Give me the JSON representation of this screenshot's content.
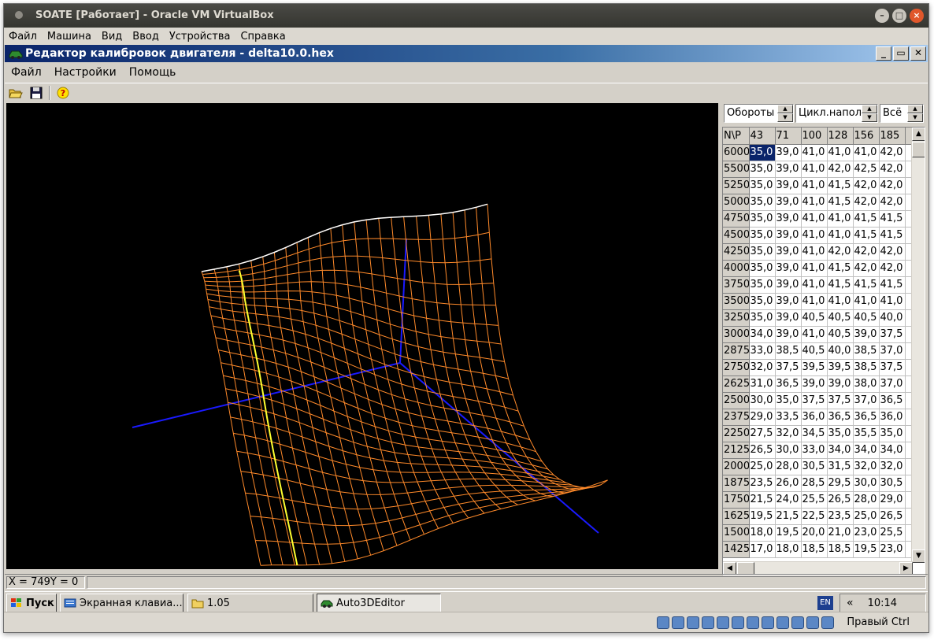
{
  "host": {
    "title": "SOATE [Работает] - Oracle VM VirtualBox",
    "menu": [
      "Файл",
      "Машина",
      "Вид",
      "Ввод",
      "Устройства",
      "Справка"
    ],
    "host_key": "Правый Ctrl"
  },
  "app": {
    "title": "Редактор калибровок двигателя - delta10.0.hex",
    "menu": [
      "Файл",
      "Настройки",
      "Помощь"
    ],
    "toolbar": [
      "open-folder-icon",
      "save-disk-icon",
      "help-icon"
    ],
    "spinners": [
      "Обороты",
      "Цикл.наполн",
      "Всё"
    ],
    "status": "X = 749Y = 0"
  },
  "table": {
    "header": [
      "N\\P",
      "43",
      "71",
      "100",
      "128",
      "156",
      "185"
    ],
    "rows": [
      [
        "6000",
        "35,0",
        "39,0",
        "41,0",
        "41,0",
        "41,0",
        "42,0"
      ],
      [
        "5500",
        "35,0",
        "39,0",
        "41,0",
        "42,0",
        "42,5",
        "42,0"
      ],
      [
        "5250",
        "35,0",
        "39,0",
        "41,0",
        "41,5",
        "42,0",
        "42,0"
      ],
      [
        "5000",
        "35,0",
        "39,0",
        "41,0",
        "41,5",
        "42,0",
        "42,0"
      ],
      [
        "4750",
        "35,0",
        "39,0",
        "41,0",
        "41,0",
        "41,5",
        "41,5"
      ],
      [
        "4500",
        "35,0",
        "39,0",
        "41,0",
        "41,0",
        "41,5",
        "41,5"
      ],
      [
        "4250",
        "35,0",
        "39,0",
        "41,0",
        "42,0",
        "42,0",
        "42,0"
      ],
      [
        "4000",
        "35,0",
        "39,0",
        "41,0",
        "41,5",
        "42,0",
        "42,0"
      ],
      [
        "3750",
        "35,0",
        "39,0",
        "41,0",
        "41,5",
        "41,5",
        "41,5"
      ],
      [
        "3500",
        "35,0",
        "39,0",
        "41,0",
        "41,0",
        "41,0",
        "41,0"
      ],
      [
        "3250",
        "35,0",
        "39,0",
        "40,5",
        "40,5",
        "40,5",
        "40,0"
      ],
      [
        "3000",
        "34,0",
        "39,0",
        "41,0",
        "40,5",
        "39,0",
        "37,5"
      ],
      [
        "2875",
        "33,0",
        "38,5",
        "40,5",
        "40,0",
        "38,5",
        "37,0"
      ],
      [
        "2750",
        "32,0",
        "37,5",
        "39,5",
        "39,5",
        "38,5",
        "37,5"
      ],
      [
        "2625",
        "31,0",
        "36,5",
        "39,0",
        "39,0",
        "38,0",
        "37,0"
      ],
      [
        "2500",
        "30,0",
        "35,0",
        "37,5",
        "37,5",
        "37,0",
        "36,5"
      ],
      [
        "2375",
        "29,0",
        "33,5",
        "36,0",
        "36,5",
        "36,5",
        "36,0"
      ],
      [
        "2250",
        "27,5",
        "32,0",
        "34,5",
        "35,0",
        "35,5",
        "35,0"
      ],
      [
        "2125",
        "26,5",
        "30,0",
        "33,0",
        "34,0",
        "34,0",
        "34,0"
      ],
      [
        "2000",
        "25,0",
        "28,0",
        "30,5",
        "31,5",
        "32,0",
        "32,0"
      ],
      [
        "1875",
        "23,5",
        "26,0",
        "28,5",
        "29,5",
        "30,0",
        "30,5"
      ],
      [
        "1750",
        "21,5",
        "24,0",
        "25,5",
        "26,5",
        "28,0",
        "29,0"
      ],
      [
        "1625",
        "19,5",
        "21,5",
        "22,5",
        "23,5",
        "25,0",
        "26,5"
      ],
      [
        "1500",
        "18,0",
        "19,5",
        "20,0",
        "21,0",
        "23,0",
        "25,5"
      ],
      [
        "1425",
        "17,0",
        "18,0",
        "18,5",
        "18,5",
        "19,5",
        "23,0"
      ]
    ]
  },
  "taskbar": {
    "start": "Пуск",
    "items": [
      "Экранная клавиа...",
      "1.05",
      "Auto3DEditor"
    ],
    "lang": "EN",
    "chevron": "«",
    "time": "10:14"
  },
  "colors": {
    "mesh": "#ff8a2a",
    "axis": "#1a1aff",
    "highlight": "#ffff30",
    "selection": "#0a246a"
  }
}
